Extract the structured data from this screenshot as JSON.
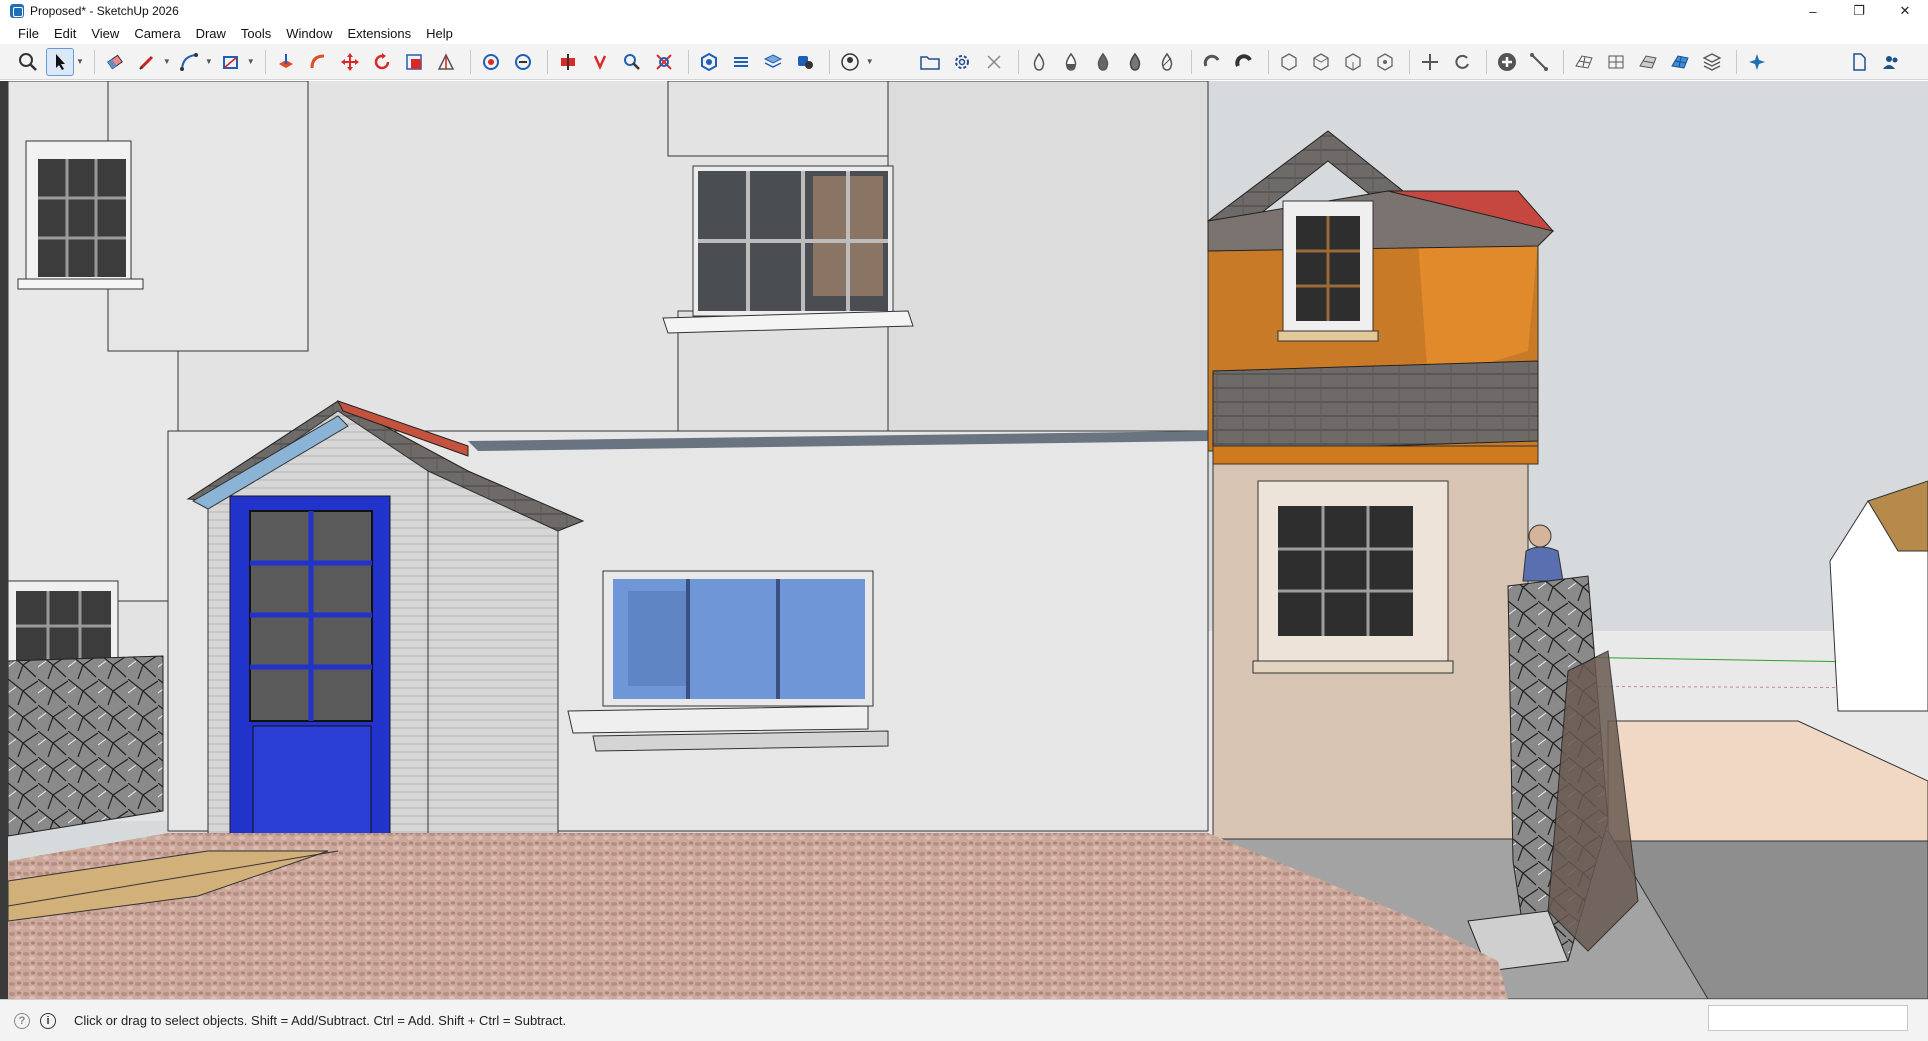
{
  "window": {
    "title": "Proposed* - SketchUp 2026",
    "controls": {
      "minimize": "–",
      "maximize": "❐",
      "close": "✕"
    }
  },
  "menu": {
    "items": [
      "File",
      "Edit",
      "View",
      "Camera",
      "Draw",
      "Tools",
      "Window",
      "Extensions",
      "Help"
    ]
  },
  "toolbar": {
    "left_tools": [
      "zoom-extents-icon",
      "select-icon",
      "eraser-icon",
      "pencil-icon",
      "arc-icon",
      "rectangle-icon",
      "push-pull-icon",
      "follow-me-icon",
      "move-icon",
      "rotate-icon",
      "scale-icon",
      "section-icon",
      "walk-icon",
      "look-around-icon",
      "position-camera-icon",
      "orbit-icon",
      "pan-icon",
      "zoom-icon",
      "zoom-window-icon",
      "materials-icon",
      "styles-icon",
      "layers-icon",
      "components-icon",
      "user-icon"
    ],
    "right_tools": [
      "open-folder-icon",
      "settings-gear-icon",
      "close-x-icon",
      "drop-1-icon",
      "drop-2-icon",
      "drop-3-icon",
      "drop-4-icon",
      "drop-5-icon",
      "magnet-1-icon",
      "magnet-2-icon",
      "hex-1-icon",
      "hex-2-icon",
      "hex-3-icon",
      "hex-4-icon",
      "arrows-in-icon",
      "refresh-icon",
      "add-circle-icon",
      "measure-line-icon",
      "mesh-1-icon",
      "mesh-2-icon",
      "mesh-3-icon",
      "mesh-4-icon",
      "stack-icon",
      "sparkle-icon",
      "new-page-icon",
      "users-icon"
    ],
    "accent_color": "#1f6fb5"
  },
  "status": {
    "hint": "Click or drag to select objects. Shift = Add/Subtract. Ctrl = Add. Shift + Ctrl = Subtract.",
    "measurements_value": ""
  },
  "scene": {
    "sky_color": "#d6d9dc",
    "wall_color": "#e4e4e4",
    "door_color": "#2233cc",
    "orange_facade": "#c97a26",
    "paving": "#c9a79a"
  }
}
